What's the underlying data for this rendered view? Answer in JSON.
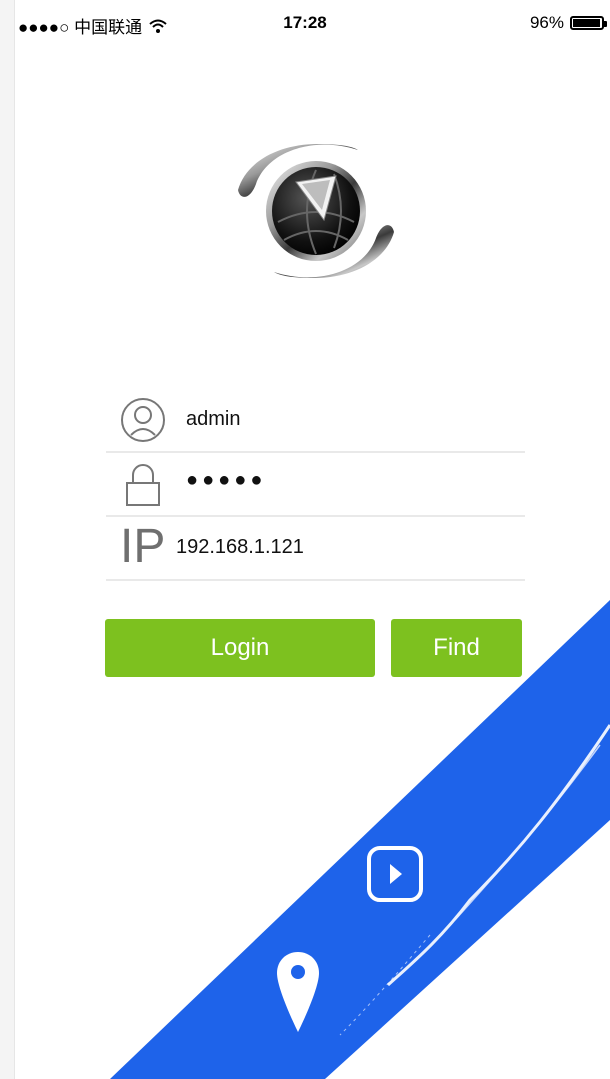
{
  "status_bar": {
    "carrier": "●●●●○ 中国联通",
    "time": "17:28",
    "battery": "96%",
    "battery_level": 0.96
  },
  "login_form": {
    "username": "admin",
    "password_mask": "●●●●●",
    "ip": "192.168.1.121"
  },
  "buttons": {
    "login": "Login",
    "find": "Find"
  },
  "icons": {
    "user": "user-outline-icon",
    "lock": "lock-outline-icon",
    "ip": "IP",
    "play": "play-icon",
    "location": "location-pin-icon",
    "wifi": "wifi-icon",
    "battery": "battery-icon"
  },
  "colors": {
    "accent_green": "#7dc11f",
    "ribbon_blue": "#1e63ea"
  }
}
